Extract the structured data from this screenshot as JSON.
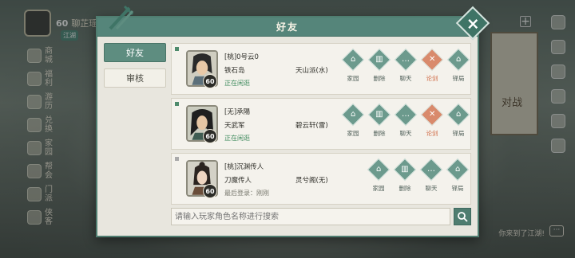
{
  "background": {
    "top_level": "60",
    "top_name": "聊芷瑶",
    "top_badge": "江湖",
    "left_menu": [
      "商城",
      "福利",
      "游历",
      "兑换",
      "家园",
      "帮会",
      "门派",
      "侠客"
    ],
    "duel_text": "对战",
    "bottom_message": "你来到了江湖!",
    "bottom_icon_text": "···"
  },
  "dialog": {
    "title": "好友",
    "tabs": [
      {
        "label": "好友",
        "active": true
      },
      {
        "label": "审核",
        "active": false
      }
    ],
    "friends": [
      {
        "name": "[桃]0号云0",
        "school": "铁石岛",
        "sect": "天山派(水)",
        "status": "正在闲逛",
        "online": true,
        "level": "60",
        "actions": [
          {
            "label": "家园",
            "icon": "house-icon",
            "color": "normal"
          },
          {
            "label": "删除",
            "icon": "trash-icon",
            "color": "normal"
          },
          {
            "label": "聊天",
            "icon": "chat-icon",
            "color": "normal"
          },
          {
            "label": "论剑",
            "icon": "crossed-swords-icon",
            "color": "red"
          },
          {
            "label": "铎局",
            "icon": "house-icon",
            "color": "normal"
          }
        ]
      },
      {
        "name": "[无]承陽",
        "school": "天武军",
        "sect": "碧云轩(雷)",
        "status": "正在闲逛",
        "online": true,
        "level": "60",
        "actions": [
          {
            "label": "家园",
            "icon": "house-icon",
            "color": "normal"
          },
          {
            "label": "删除",
            "icon": "trash-icon",
            "color": "normal"
          },
          {
            "label": "聊天",
            "icon": "chat-icon",
            "color": "normal"
          },
          {
            "label": "论剑",
            "icon": "crossed-swords-icon",
            "color": "red"
          },
          {
            "label": "铎局",
            "icon": "house-icon",
            "color": "normal"
          }
        ]
      },
      {
        "name": "[桃]沉渊传人",
        "school": "刀魔传人",
        "sect": "灵兮阁(无)",
        "status": "最后登录：刚刚",
        "online": false,
        "level": "60",
        "actions": [
          {
            "label": "家园",
            "icon": "house-icon",
            "color": "normal"
          },
          {
            "label": "删除",
            "icon": "trash-icon",
            "color": "normal"
          },
          {
            "label": "聊天",
            "icon": "chat-icon",
            "color": "normal"
          },
          {
            "label": "铎局",
            "icon": "house-icon",
            "color": "normal"
          }
        ]
      }
    ],
    "search": {
      "placeholder": "请输入玩家角色名称进行搜索"
    }
  },
  "colors": {
    "accent": "#55857a",
    "danger": "#d98a6c",
    "online": "#3d8a5c"
  }
}
